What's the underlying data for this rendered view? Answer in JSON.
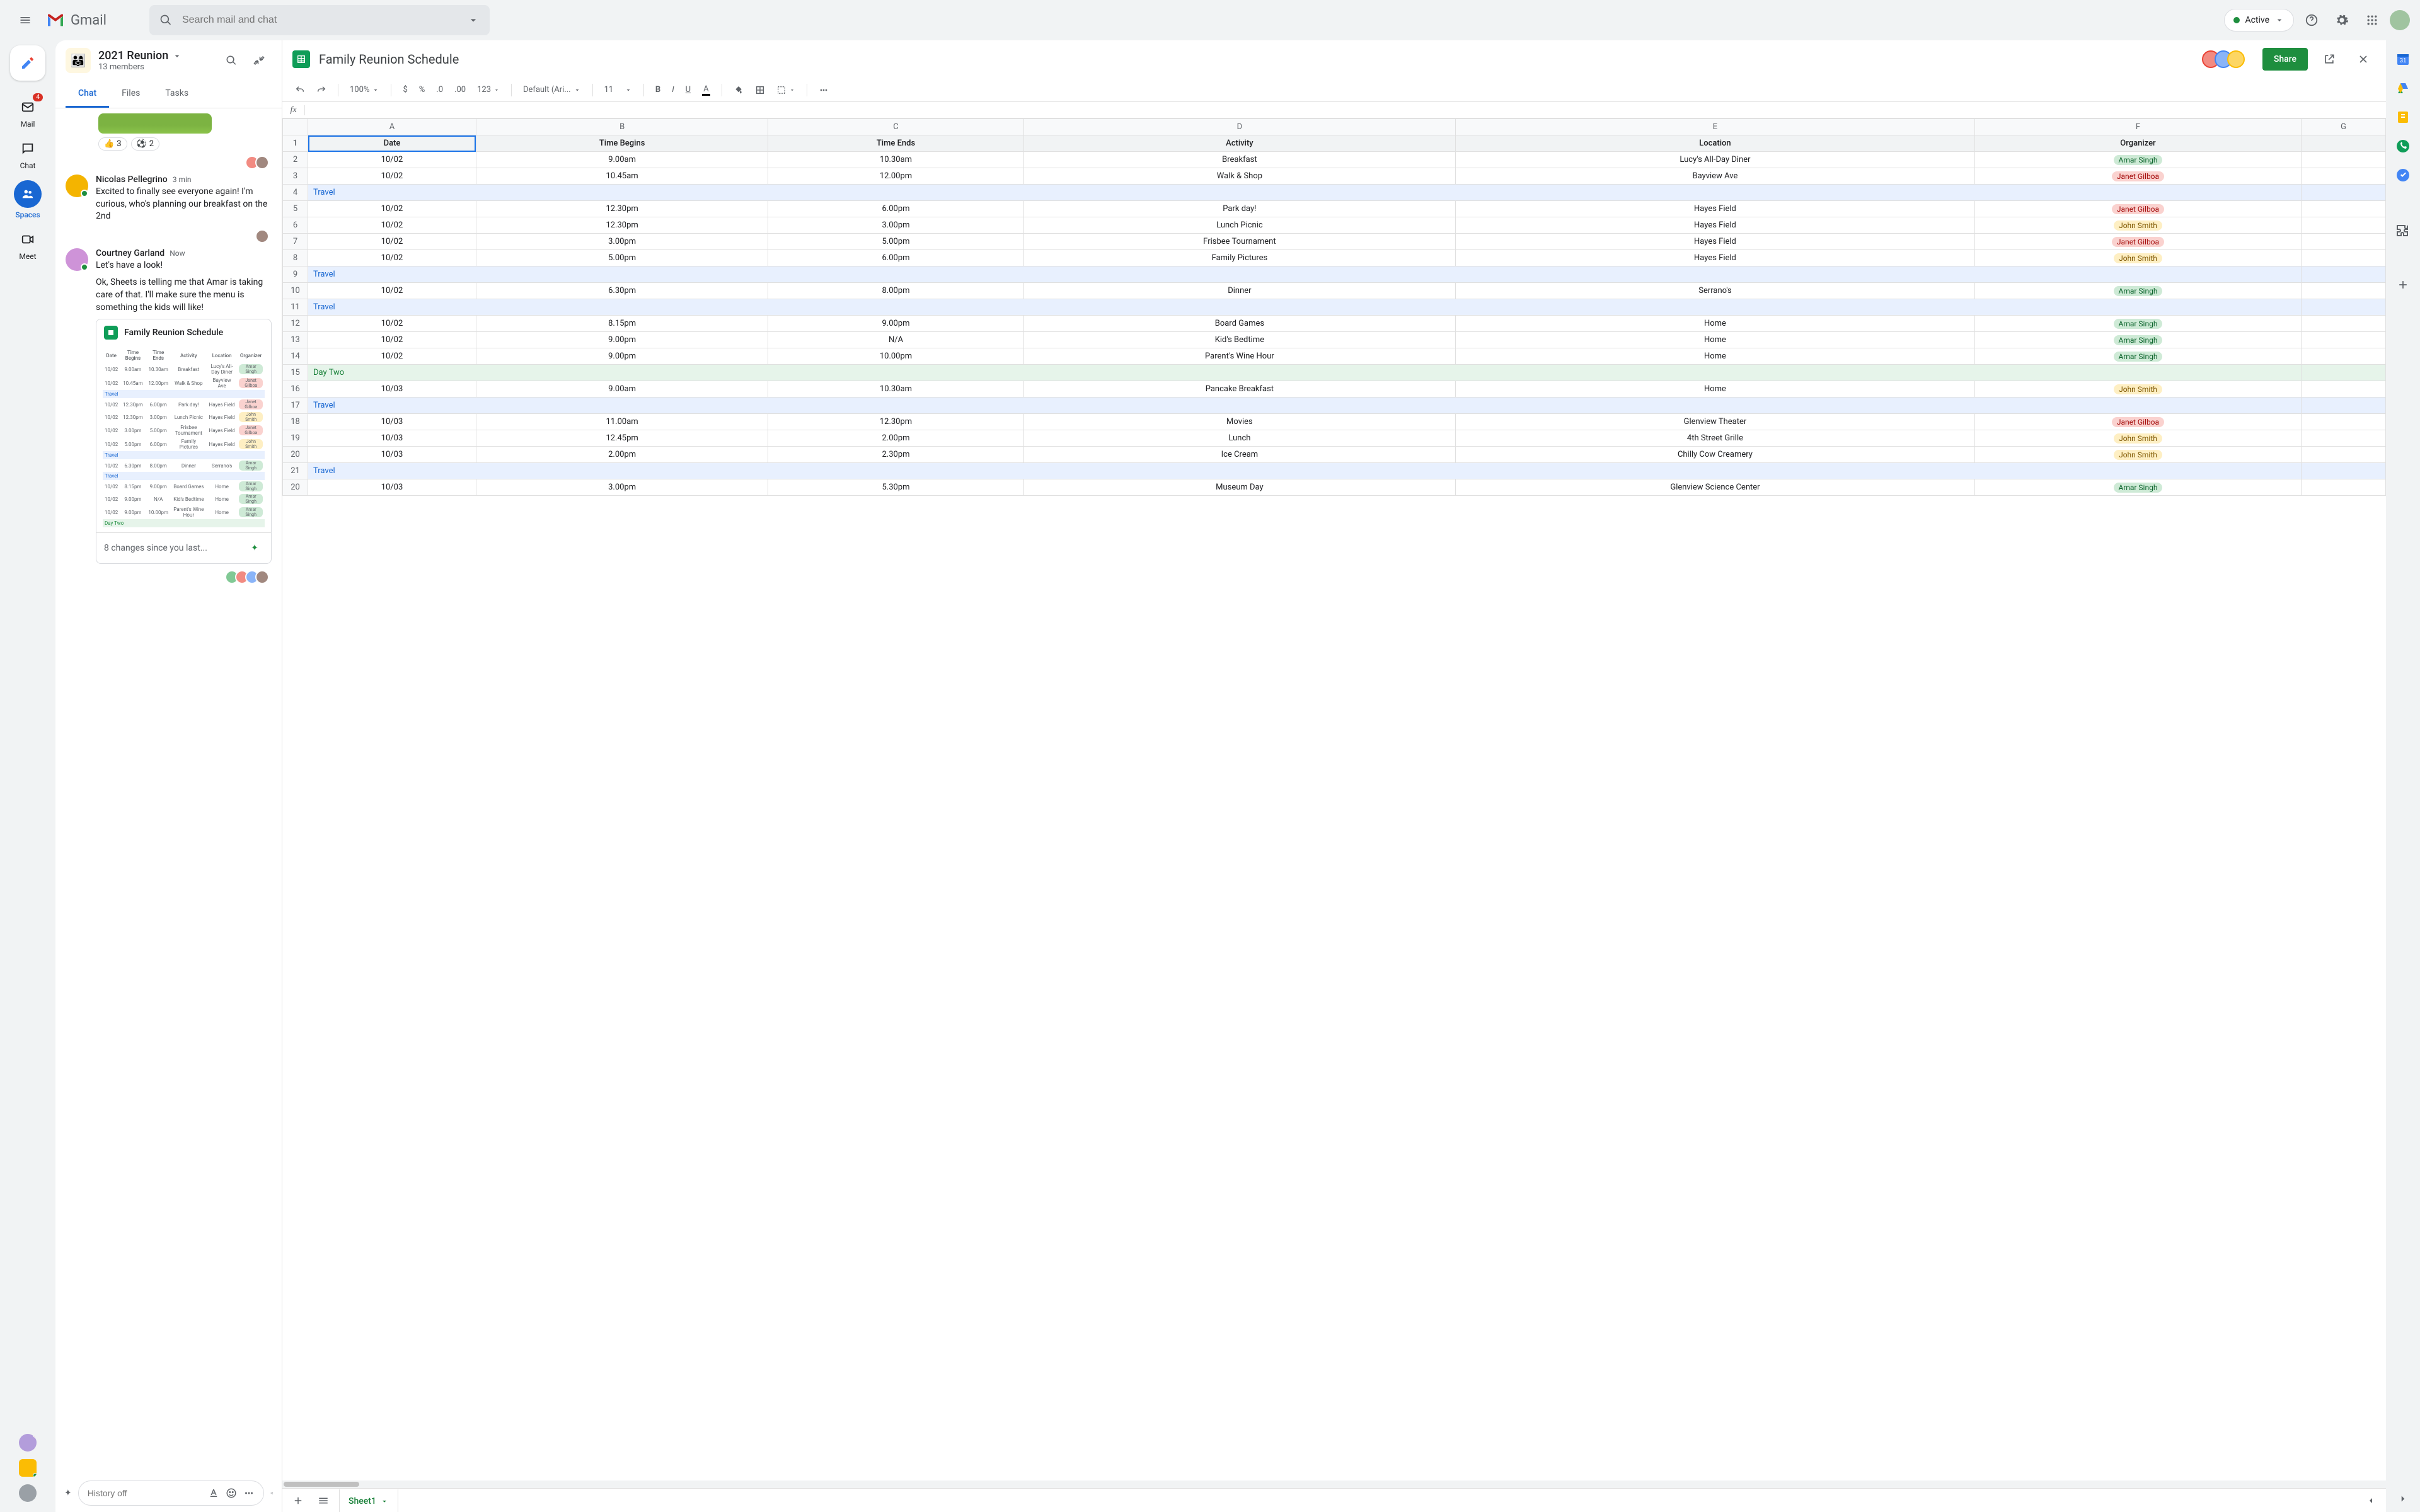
{
  "app": {
    "name": "Gmail",
    "search_placeholder": "Search mail and chat",
    "status": "Active"
  },
  "nav": {
    "mail": "Mail",
    "mail_badge": "4",
    "chat": "Chat",
    "spaces": "Spaces",
    "meet": "Meet"
  },
  "space": {
    "title": "2021 Reunion",
    "members": "13 members",
    "tabs": {
      "chat": "Chat",
      "files": "Files",
      "tasks": "Tasks"
    }
  },
  "reactions": {
    "thumbs": "3",
    "soccer": "2"
  },
  "messages": [
    {
      "author": "Nicolas Pellegrino",
      "time": "3 min",
      "lines": [
        "Excited to finally see everyone again! I'm curious, who's planning our breakfast on the 2nd"
      ]
    },
    {
      "author": "Courtney Garland",
      "time": "Now",
      "lines": [
        "Let's have a look!",
        "Ok, Sheets is telling me that Amar is taking care of that. I'll make sure the menu is something the kids will like!"
      ]
    }
  ],
  "card": {
    "title": "Family Reunion Schedule",
    "footer": "8 changes since you last..."
  },
  "compose": {
    "placeholder": "History off"
  },
  "sheet": {
    "title": "Family Reunion Schedule",
    "share": "Share",
    "zoom": "100%",
    "font": "Default (Ari...",
    "size": "11",
    "fmt_num": "123",
    "tab": "Sheet1",
    "cols": [
      "A",
      "B",
      "C",
      "D",
      "E",
      "F",
      "G"
    ],
    "headers": [
      "Date",
      "Time Begins",
      "Time Ends",
      "Activity",
      "Location",
      "Organizer"
    ],
    "rows": [
      {
        "n": 2,
        "c": [
          "10/02",
          "9.00am",
          "10.30am",
          "Breakfast",
          "Lucy's All-Day Diner"
        ],
        "org": "Amar Singh",
        "p": "teal"
      },
      {
        "n": 3,
        "c": [
          "10/02",
          "10.45am",
          "12.00pm",
          "Walk & Shop",
          "Bayview Ave"
        ],
        "org": "Janet Gilboa",
        "p": "pink"
      },
      {
        "n": 4,
        "travel": "Travel"
      },
      {
        "n": 5,
        "c": [
          "10/02",
          "12.30pm",
          "6.00pm",
          "Park day!",
          "Hayes Field"
        ],
        "org": "Janet Gilboa",
        "p": "pink"
      },
      {
        "n": 6,
        "c": [
          "10/02",
          "12.30pm",
          "3.00pm",
          "Lunch Picnic",
          "Hayes Field"
        ],
        "org": "John Smith",
        "p": "yellow"
      },
      {
        "n": 7,
        "c": [
          "10/02",
          "3.00pm",
          "5.00pm",
          "Frisbee Tournament",
          "Hayes Field"
        ],
        "org": "Janet Gilboa",
        "p": "pink"
      },
      {
        "n": 8,
        "c": [
          "10/02",
          "5.00pm",
          "6.00pm",
          "Family Pictures",
          "Hayes Field"
        ],
        "org": "John Smith",
        "p": "yellow"
      },
      {
        "n": 9,
        "travel": "Travel"
      },
      {
        "n": 10,
        "c": [
          "10/02",
          "6.30pm",
          "8.00pm",
          "Dinner",
          "Serrano's"
        ],
        "org": "Amar Singh",
        "p": "teal"
      },
      {
        "n": 11,
        "travel": "Travel"
      },
      {
        "n": 12,
        "c": [
          "10/02",
          "8.15pm",
          "9.00pm",
          "Board Games",
          "Home"
        ],
        "org": "Amar Singh",
        "p": "teal"
      },
      {
        "n": 13,
        "c": [
          "10/02",
          "9.00pm",
          "N/A",
          "Kid's Bedtime",
          "Home"
        ],
        "org": "Amar Singh",
        "p": "teal"
      },
      {
        "n": 14,
        "c": [
          "10/02",
          "9.00pm",
          "10.00pm",
          "Parent's Wine Hour",
          "Home"
        ],
        "org": "Amar Singh",
        "p": "teal"
      },
      {
        "n": 15,
        "day": "Day Two"
      },
      {
        "n": 16,
        "c": [
          "10/03",
          "9.00am",
          "10.30am",
          "Pancake Breakfast",
          "Home"
        ],
        "org": "John Smith",
        "p": "yellow"
      },
      {
        "n": 17,
        "travel": "Travel"
      },
      {
        "n": 18,
        "c": [
          "10/03",
          "11.00am",
          "12.30pm",
          "Movies",
          "Glenview Theater"
        ],
        "org": "Janet Gilboa",
        "p": "pink"
      },
      {
        "n": 19,
        "c": [
          "10/03",
          "12.45pm",
          "2.00pm",
          "Lunch",
          "4th Street Grille"
        ],
        "org": "John Smith",
        "p": "yellow"
      },
      {
        "n": 20,
        "c": [
          "10/03",
          "2.00pm",
          "2.30pm",
          "Ice Cream",
          "Chilly Cow Creamery"
        ],
        "org": "John Smith",
        "p": "yellow"
      },
      {
        "n": 21,
        "travel": "Travel"
      },
      {
        "n": 20,
        "dup": true,
        "c": [
          "10/03",
          "3.00pm",
          "5.30pm",
          "Museum Day",
          "Glenview Science Center"
        ],
        "org": "Amar Singh",
        "p": "teal"
      }
    ]
  }
}
